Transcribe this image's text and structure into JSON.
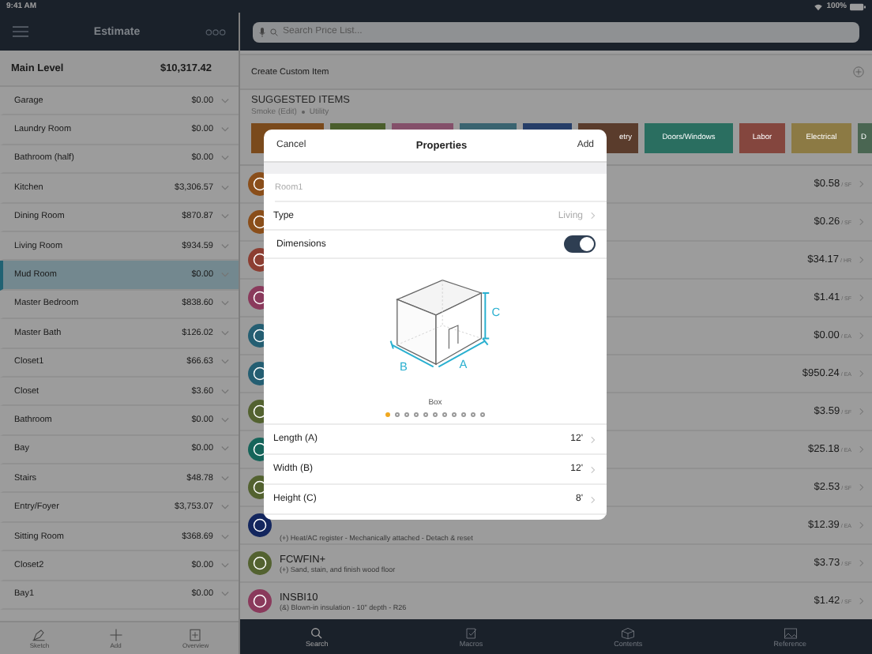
{
  "status_bar": {
    "time": "9:41 AM",
    "battery": "100%"
  },
  "sidebar": {
    "title": "Estimate",
    "summary": {
      "label": "Main Level",
      "total": "$10,317.42"
    },
    "rooms": [
      {
        "name": "Garage",
        "total": "$0.00",
        "selected": false
      },
      {
        "name": "Laundry Room",
        "total": "$0.00",
        "selected": false
      },
      {
        "name": "Bathroom (half)",
        "total": "$0.00",
        "selected": false
      },
      {
        "name": "Kitchen",
        "total": "$3,306.57",
        "selected": false
      },
      {
        "name": "Dining Room",
        "total": "$870.87",
        "selected": false
      },
      {
        "name": "Living Room",
        "total": "$934.59",
        "selected": false
      },
      {
        "name": "Mud Room",
        "total": "$0.00",
        "selected": true
      },
      {
        "name": "Master Bedroom",
        "total": "$838.60",
        "selected": false
      },
      {
        "name": "Master Bath",
        "total": "$126.02",
        "selected": false
      },
      {
        "name": "Closet1",
        "total": "$66.63",
        "selected": false
      },
      {
        "name": "Closet",
        "total": "$3.60",
        "selected": false
      },
      {
        "name": "Bathroom",
        "total": "$0.00",
        "selected": false
      },
      {
        "name": "Bay",
        "total": "$0.00",
        "selected": false
      },
      {
        "name": "Stairs",
        "total": "$48.78",
        "selected": false
      },
      {
        "name": "Entry/Foyer",
        "total": "$3,753.07",
        "selected": false
      },
      {
        "name": "Sitting Room",
        "total": "$368.69",
        "selected": false
      },
      {
        "name": "Closet2",
        "total": "$0.00",
        "selected": false
      },
      {
        "name": "Bay1",
        "total": "$0.00",
        "selected": false
      }
    ],
    "tabs": [
      {
        "label": "Sketch",
        "kind": "sketch"
      },
      {
        "label": "Add",
        "kind": "add"
      },
      {
        "label": "Overview",
        "kind": "overview"
      }
    ]
  },
  "search": {
    "placeholder": "Search Price List..."
  },
  "create_custom_item": "Create Custom Item",
  "suggested": {
    "title": "SUGGESTED ITEMS",
    "breadcrumb": [
      "Smoke (Edit)",
      "Utility"
    ],
    "categories": [
      {
        "color": "#7a4a1c"
      },
      {
        "color": "#4a5e2c"
      },
      {
        "color": "#84506a"
      },
      {
        "color": "#3a6470"
      },
      {
        "color": "#263e68"
      },
      {
        "label": "etry",
        "color": "#5a3c2c"
      },
      {
        "label": "Doors/Windows",
        "color": "#2a6e60"
      },
      {
        "label": "Labor",
        "color": "#84463e"
      },
      {
        "label": "Electrical",
        "color": "#8c7a44"
      },
      {
        "label": "D",
        "color": "#4a6652"
      }
    ]
  },
  "items": [
    {
      "price": "$0.58",
      "unit": "/ SF",
      "color": "#8a4e1a"
    },
    {
      "price": "$0.26",
      "unit": "/ SF",
      "color": "#8a4e1a"
    },
    {
      "price": "$34.17",
      "unit": "/ HR",
      "color": "#8c3e32"
    },
    {
      "price": "$1.41",
      "unit": "/ SF",
      "color": "#8a3a5c"
    },
    {
      "price": "$0.00",
      "unit": "/ EA",
      "color": "#245e72"
    },
    {
      "price": "$950.24",
      "unit": "/ EA",
      "color": "#245e72"
    },
    {
      "price": "$3.59",
      "unit": "/ SF",
      "color": "#536230"
    },
    {
      "price": "$25.18",
      "unit": "/ EA",
      "color": "#16645a"
    },
    {
      "price": "$2.53",
      "unit": "/ SF",
      "color": "#536230"
    },
    {
      "description": "(+) Heat/AC register - Mechanically attached - Detach & reset",
      "price": "$12.39",
      "unit": "/ EA",
      "color": "#13265e"
    },
    {
      "code": "FCWFIN+",
      "description": "(+) Sand, stain, and finish wood floor",
      "price": "$3.73",
      "unit": "/ SF",
      "color": "#536230"
    },
    {
      "code": "INSBI10",
      "description": "(&) Blown-in insulation - 10\" depth - R26",
      "price": "$1.42",
      "unit": "/ SF",
      "color": "#8a3a5c"
    }
  ],
  "tab_bar": [
    {
      "label": "Search",
      "kind": "search",
      "selected": true
    },
    {
      "label": "Macros",
      "kind": "macros",
      "selected": false
    },
    {
      "label": "Contents",
      "kind": "contents",
      "selected": false
    },
    {
      "label": "Reference",
      "kind": "reference",
      "selected": false
    }
  ],
  "modal": {
    "cancel": "Cancel",
    "title": "Properties",
    "add": "Add",
    "name_placeholder": "Room1",
    "type": {
      "label": "Type",
      "value": "Living"
    },
    "dimensions": {
      "label": "Dimensions",
      "on": true
    },
    "diagram_labels": [
      "A",
      "B",
      "C"
    ],
    "shape": {
      "caption": "Box",
      "pages": [
        {
          "selected": true
        },
        {
          "selected": false
        },
        {
          "selected": false
        },
        {
          "selected": false
        },
        {
          "selected": false
        },
        {
          "selected": false
        },
        {
          "selected": false
        },
        {
          "selected": false
        },
        {
          "selected": false
        },
        {
          "selected": false
        },
        {
          "selected": false
        }
      ]
    },
    "measurements": [
      {
        "label": "Length (A)",
        "value": "12'"
      },
      {
        "label": "Width (B)",
        "value": "12'"
      },
      {
        "label": "Height (C)",
        "value": "8'"
      }
    ]
  }
}
